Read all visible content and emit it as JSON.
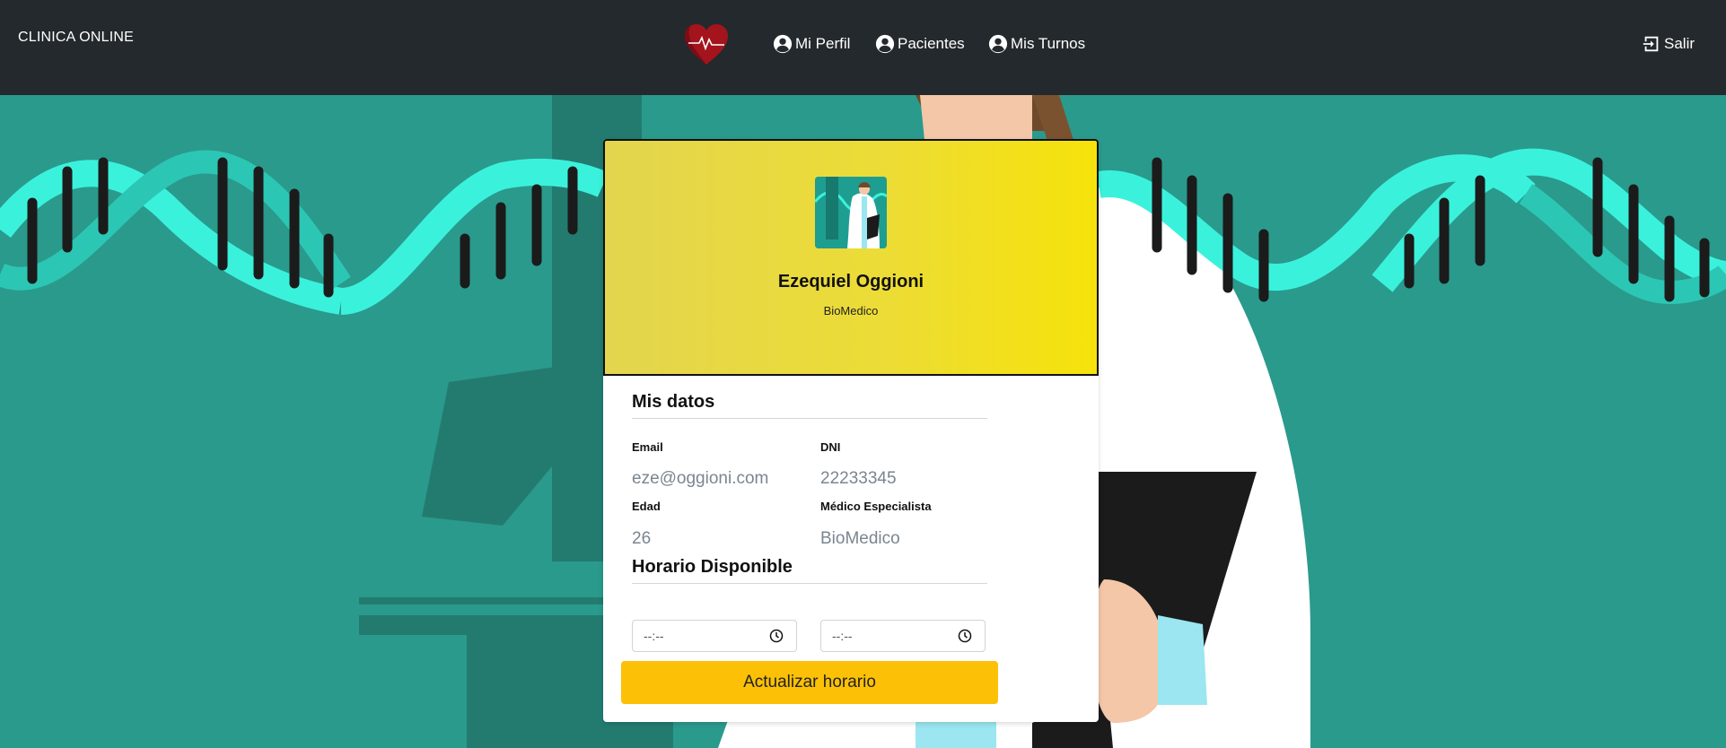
{
  "navbar": {
    "brand": "CLINICA ONLINE",
    "items": [
      {
        "label": "Mi Perfil",
        "icon": "user-circle-icon"
      },
      {
        "label": "Pacientes",
        "icon": "user-circle-icon"
      },
      {
        "label": "Mis Turnos",
        "icon": "user-circle-icon"
      }
    ],
    "logout_label": "Salir",
    "logo_icon": "heart-pulse-icon"
  },
  "profile": {
    "name": "Ezequiel Oggioni",
    "role": "BioMedico",
    "avatar_icon": "doctor-avatar"
  },
  "mis_datos": {
    "title": "Mis datos",
    "fields": [
      {
        "label": "Email",
        "value": "eze@oggioni.com"
      },
      {
        "label": "DNI",
        "value": "22233345"
      },
      {
        "label": "Edad",
        "value": "26"
      },
      {
        "label": "Médico Especialista",
        "value": "BioMedico"
      }
    ]
  },
  "horario": {
    "title": "Horario Disponible",
    "start_placeholder": "--:--",
    "end_placeholder": "--:--",
    "button_label": "Actualizar horario"
  },
  "colors": {
    "navbar": "#23292d",
    "background": "#2a9a8c",
    "dna_light": "#3af2dc",
    "header_gradient_start": "#e3d54e",
    "header_gradient_end": "#f6e20a",
    "button": "#fcc107",
    "heart": "#a3141d"
  }
}
